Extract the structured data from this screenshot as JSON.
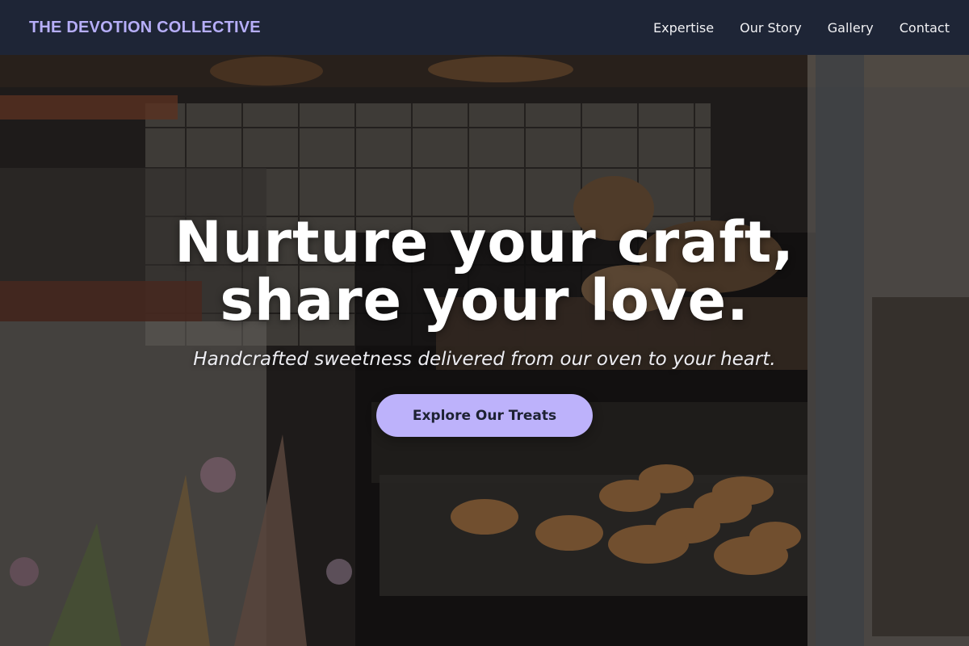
{
  "header": {
    "brand": "THE DEVOTION COLLECTIVE",
    "nav": [
      "Expertise",
      "Our Story",
      "Gallery",
      "Contact"
    ]
  },
  "hero": {
    "title_line1": "Nurture your craft,",
    "title_line2": "share your love.",
    "subtitle": "Handcrafted sweetness delivered from our oven to your heart.",
    "cta_label": "Explore Our Treats",
    "background_image": "bakery display case with pastries, bread and dried flowers"
  },
  "colors": {
    "header_bg": "#1e2536",
    "brand": "#b6aef8",
    "cta_bg": "#bdb2fb",
    "cta_text": "#1e2233"
  }
}
